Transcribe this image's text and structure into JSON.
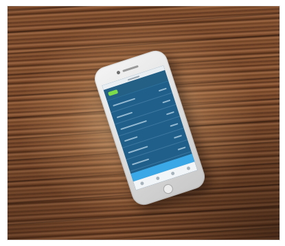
{
  "scene": {
    "description_icon": "phone-on-wooden-table",
    "colors": {
      "wood_dark": "#5a331d",
      "wood_light": "#9c6642",
      "phone_body": "#e6e6e6",
      "app_background": "#1f5f89",
      "app_accent": "#3aa8e6",
      "app_tag": "#7ddc4a"
    }
  },
  "phone": {
    "app_rows_count": 6
  }
}
